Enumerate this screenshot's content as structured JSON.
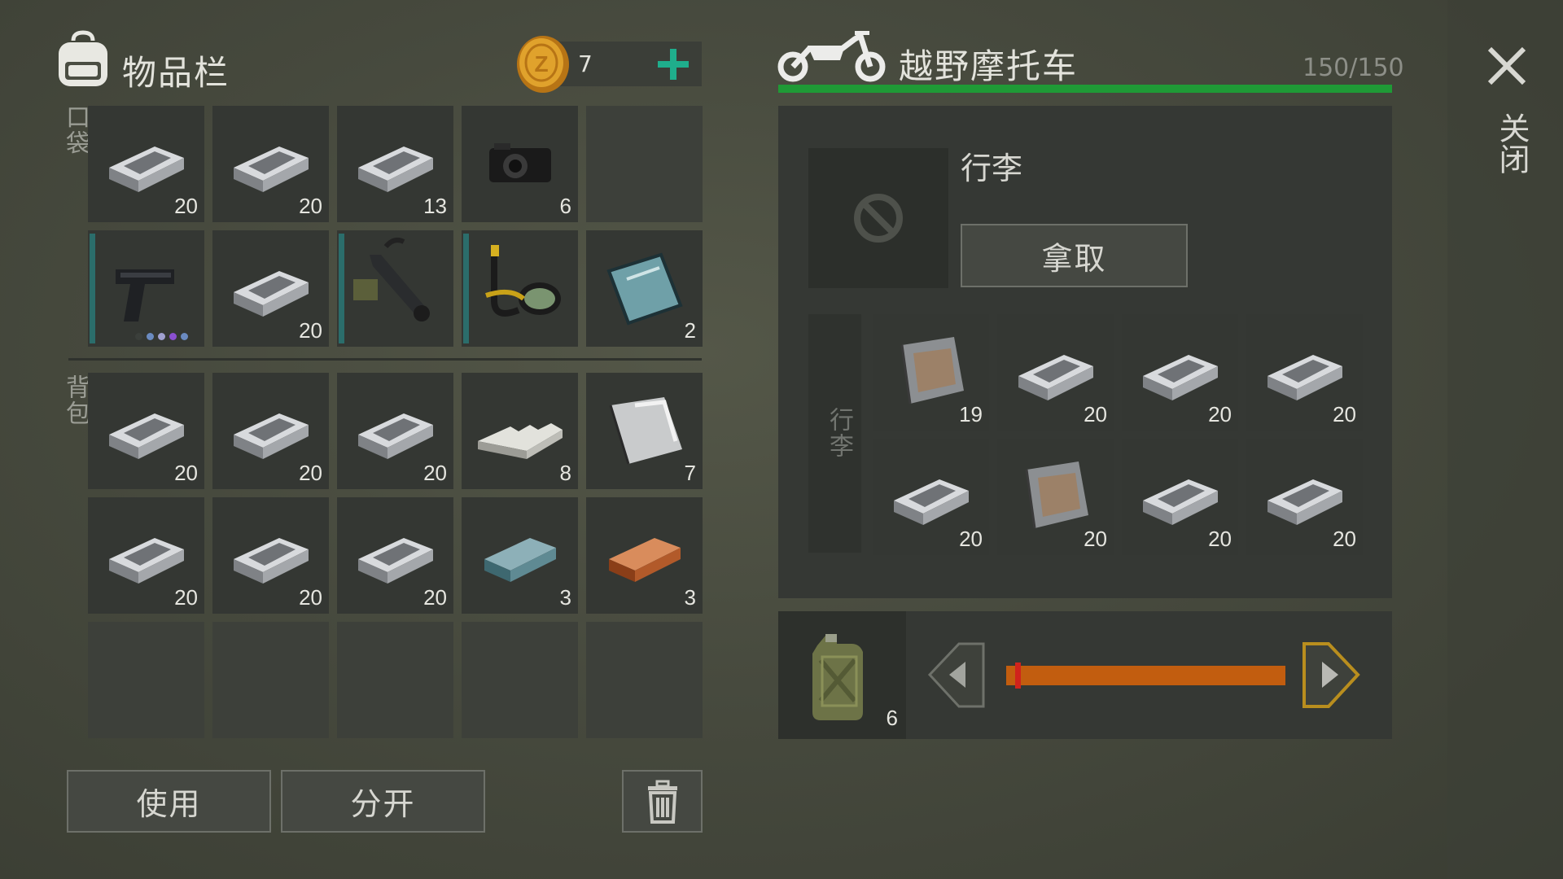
{
  "inventory": {
    "title": "物品栏",
    "coins": "7",
    "pocket_label": "口袋",
    "backpack_label": "背包",
    "pocket_slots": [
      {
        "item": "steel-ingot-icon",
        "count": "20"
      },
      {
        "item": "steel-ingot-icon",
        "count": "20"
      },
      {
        "item": "steel-ingot-icon",
        "count": "13"
      },
      {
        "item": "camera-icon",
        "count": "6"
      },
      {
        "item": "empty",
        "count": ""
      },
      {
        "item": "pistol-icon",
        "count": ""
      },
      {
        "item": "steel-ingot-icon",
        "count": "20"
      },
      {
        "item": "grenade-launcher-icon",
        "count": ""
      },
      {
        "item": "snorkel-mask-icon",
        "count": ""
      },
      {
        "item": "glass-sheet-icon",
        "count": "2"
      }
    ],
    "backpack_slots": [
      {
        "item": "steel-ingot-icon",
        "count": "20"
      },
      {
        "item": "steel-ingot-icon",
        "count": "20"
      },
      {
        "item": "steel-ingot-icon",
        "count": "20"
      },
      {
        "item": "aluminum-bar-icon",
        "count": "8"
      },
      {
        "item": "metal-sheet-icon",
        "count": "7"
      },
      {
        "item": "steel-ingot-icon",
        "count": "20"
      },
      {
        "item": "steel-ingot-icon",
        "count": "20"
      },
      {
        "item": "steel-ingot-icon",
        "count": "20"
      },
      {
        "item": "titanium-ingot-icon",
        "count": "3"
      },
      {
        "item": "copper-ingot-icon",
        "count": "3"
      }
    ],
    "use_button": "使用",
    "split_button": "分开"
  },
  "vehicle": {
    "title": "越野摩托车",
    "durability": "150/150",
    "durability_fraction": 1.0,
    "luggage_title": "行李",
    "take_button": "拿取",
    "luggage_label": "行李",
    "luggage_slots": [
      {
        "item": "rusty-plate-icon",
        "count": "19"
      },
      {
        "item": "steel-ingot-icon",
        "count": "20"
      },
      {
        "item": "steel-ingot-icon",
        "count": "20"
      },
      {
        "item": "steel-ingot-icon",
        "count": "20"
      },
      {
        "item": "steel-ingot-icon",
        "count": "20"
      },
      {
        "item": "rusty-plate-icon",
        "count": "20"
      },
      {
        "item": "steel-ingot-icon",
        "count": "20"
      },
      {
        "item": "steel-ingot-icon",
        "count": "20"
      }
    ],
    "fuel_count": "6",
    "fuel_level": 0.02
  },
  "close_label": "关闭",
  "colors": {
    "accent_green": "#1f9a36",
    "plus_teal": "#1fae8c",
    "fuel_orange": "#c25d0f",
    "marker_red": "#d0231c",
    "arrow_gold": "#b98e1e"
  }
}
